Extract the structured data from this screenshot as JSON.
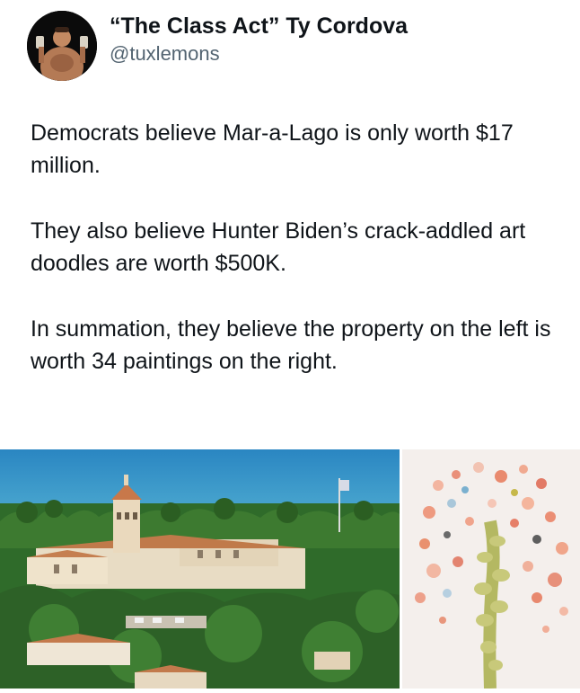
{
  "author": {
    "display_name": "“The Class Act” Ty Cordova",
    "handle": "@tuxlemons",
    "avatar_icon": "profile-photo"
  },
  "tweet": {
    "paragraphs": [
      "Democrats believe Mar-a-Lago is only worth $17 million.",
      "They also believe Hunter Biden’s crack-addled art doodles are worth $500K.",
      "In summation, they believe the property on the left is worth 34 paintings on the right."
    ]
  },
  "media": {
    "left_image": "aerial-photo-estate",
    "right_image": "painting-abstract-dots"
  },
  "colors": {
    "text": "#0f1419",
    "muted": "#536471",
    "ocean": "#1f7fb8",
    "foliage": "#2f6b2a",
    "painting_bg": "#f4efec"
  }
}
